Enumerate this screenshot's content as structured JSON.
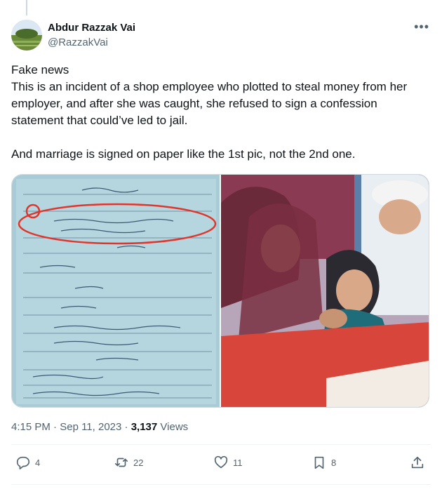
{
  "author": {
    "display_name": "Abdur Razzak Vai",
    "handle": "@RazzakVai"
  },
  "tweet": {
    "lines": [
      "Fake news",
      "This is an incident of a shop employee who plotted to steal money from her employer, and after she was caught, she refused to sign a confession statement that could’ve led to jail.",
      "And marriage is signed on paper like the 1st pic, not the 2nd one."
    ]
  },
  "meta": {
    "time": "4:15 PM",
    "sep": "·",
    "date": "Sep 11, 2023",
    "views_count": "3,137",
    "views_label": "Views"
  },
  "actions": {
    "replies": "4",
    "reposts": "22",
    "likes": "11",
    "bookmarks": "8"
  },
  "icons": [
    "more-icon",
    "reply-icon",
    "repost-icon",
    "like-icon",
    "bookmark-icon",
    "share-icon"
  ],
  "colors": {
    "text": "#0f1419",
    "muted": "#536471",
    "border": "#cfd9de"
  }
}
